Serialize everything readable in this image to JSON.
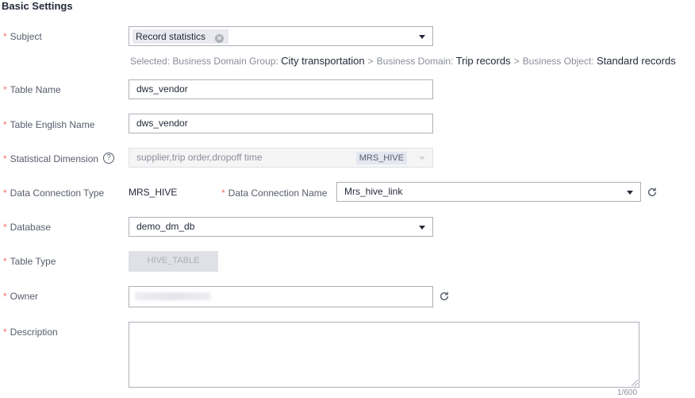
{
  "section_title": "Basic Settings",
  "subject": {
    "label": "Subject",
    "chip": "Record statistics",
    "selected_prefix": "Selected:",
    "path": [
      {
        "key": "Business Domain Group:",
        "value": "City transportation"
      },
      {
        "key": "Business Domain:",
        "value": "Trip records"
      },
      {
        "key": "Business Object:",
        "value": "Standard records"
      }
    ],
    "separator": ">"
  },
  "table_name": {
    "label": "Table Name",
    "value": "dws_vendor"
  },
  "table_english_name": {
    "label": "Table English Name",
    "value": "dws_vendor"
  },
  "statistical_dimension": {
    "label": "Statistical Dimension",
    "help": "?",
    "value": "supplier,trip order,dropoff time",
    "tag": "MRS_HIVE"
  },
  "data_connection_type": {
    "label": "Data Connection Type",
    "value": "MRS_HIVE"
  },
  "data_connection_name": {
    "label": "Data Connection Name",
    "value": "Mrs_hive_link"
  },
  "database": {
    "label": "Database",
    "value": "demo_dm_db"
  },
  "table_type": {
    "label": "Table Type",
    "value": "HIVE_TABLE"
  },
  "owner": {
    "label": "Owner",
    "value": ""
  },
  "description": {
    "label": "Description",
    "value": "",
    "counter": "1/600"
  },
  "required_mark": "*",
  "icons": {
    "refresh": "refresh-icon",
    "caret": "chevron-down-icon",
    "clear": "clear-icon",
    "help": "help-icon"
  }
}
